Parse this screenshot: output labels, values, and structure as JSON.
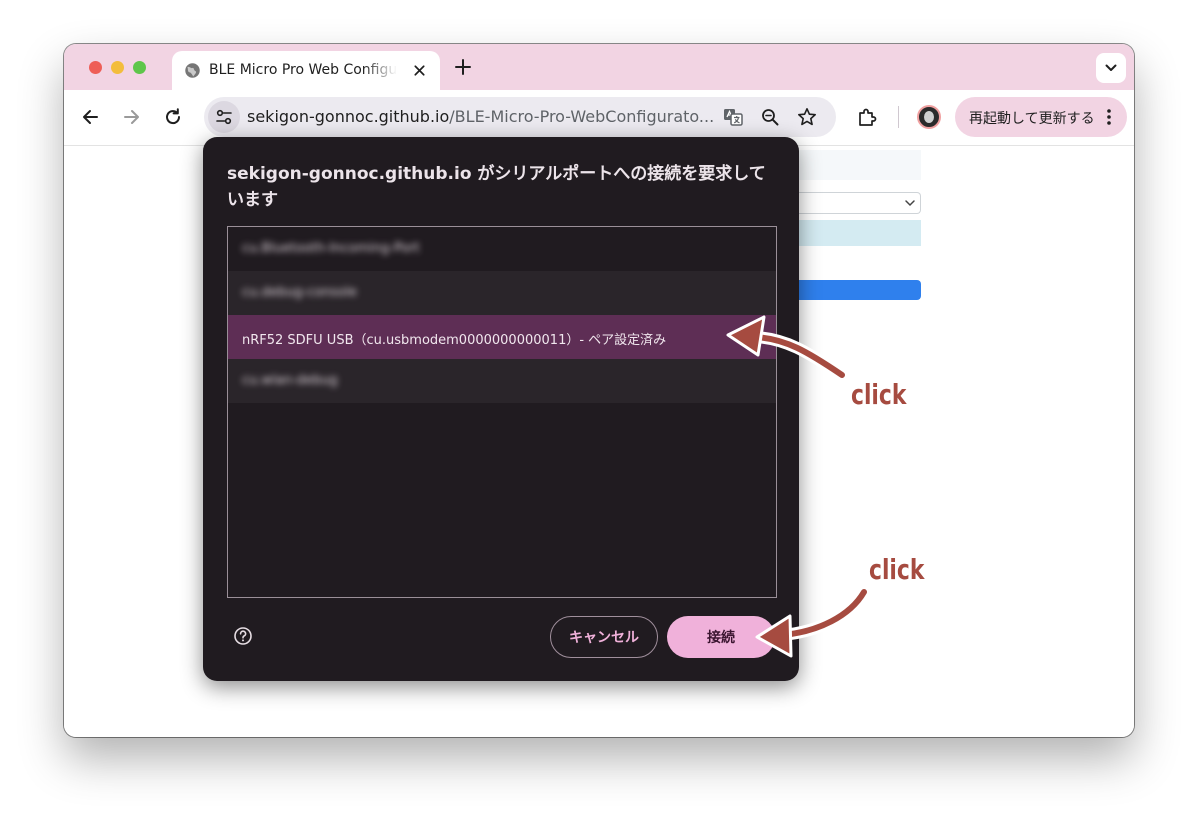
{
  "browser": {
    "tab": {
      "title": "BLE Micro Pro Web Configurator"
    },
    "omnibox": {
      "url_host": "sekigon-gonnoc.github.io",
      "url_path": "/BLE-Micro-Pro-WebConfigurato..."
    },
    "restart_button": {
      "label": "再起動して更新する"
    }
  },
  "dialog": {
    "title": "sekigon-gonnoc.github.io がシリアルポートへの接続を要求しています",
    "devices": [
      {
        "label": "cu.Bluetooth-Incoming-Port",
        "state": "blurred"
      },
      {
        "label": "cu.debug-console",
        "state": "blurred"
      },
      {
        "label": "nRF52 SDFU USB（cu.usbmodem0000000000011）- ペア設定済み",
        "state": "selected"
      },
      {
        "label": "cu.wlan-debug",
        "state": "blurred"
      }
    ],
    "cancel_label": "キャンセル",
    "connect_label": "接続"
  },
  "annotations": [
    {
      "text": "click"
    },
    {
      "text": "click"
    }
  ],
  "colors": {
    "tab_strip": "#f2d4e3",
    "dialog_bg": "#201b20",
    "selected_row": "#5e2e55",
    "connect_button": "#f0b1da",
    "annotation": "#a64b40"
  }
}
